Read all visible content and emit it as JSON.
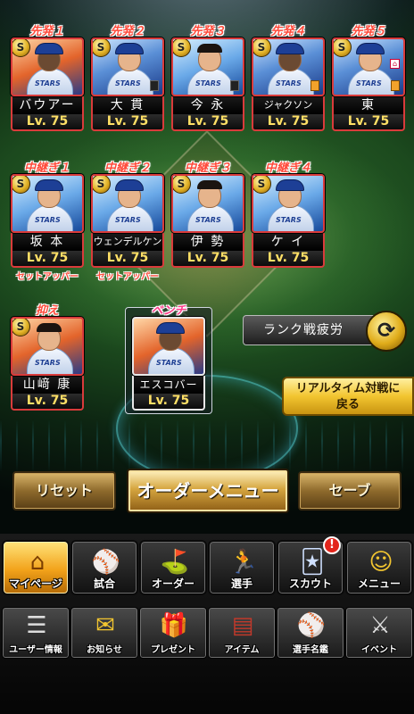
{
  "rotation": [
    {
      "label": "先発１",
      "name": "バウアー",
      "level": "Lv. 75",
      "badge": "S",
      "marker": "",
      "bg": "red-bg",
      "dark": true,
      "cap": true
    },
    {
      "label": "先発２",
      "name": "大 貫",
      "level": "Lv. 75",
      "badge": "S",
      "marker": "black",
      "bg": "",
      "dark": false,
      "cap": true
    },
    {
      "label": "先発３",
      "name": "今 永",
      "level": "Lv. 75",
      "badge": "S",
      "marker": "black",
      "bg": "blue-bg",
      "dark": false,
      "cap": false
    },
    {
      "label": "先発４",
      "name": "ジャクソン",
      "level": "Lv. 75",
      "badge": "S",
      "marker": "orange",
      "bg": "",
      "dark": true,
      "cap": true
    },
    {
      "label": "先発５",
      "name": "東",
      "level": "Lv. 75",
      "badge": "S",
      "marker": "orange",
      "bg": "",
      "dark": false,
      "cap": true
    }
  ],
  "relievers": [
    {
      "label": "中継ぎ１",
      "name": "坂 本",
      "level": "Lv. 75",
      "badge": "S",
      "role": "セットアッパー"
    },
    {
      "label": "中継ぎ２",
      "name": "ウェンデルケン",
      "level": "Lv. 75",
      "badge": "S",
      "role": "セットアッパー"
    },
    {
      "label": "中継ぎ３",
      "name": "伊 勢",
      "level": "Lv. 75",
      "badge": "S",
      "role": ""
    },
    {
      "label": "中継ぎ４",
      "name": "ケ イ",
      "level": "Lv. 75",
      "badge": "S",
      "role": ""
    }
  ],
  "closer": {
    "label": "抑え",
    "name": "山﨑 康",
    "level": "Lv. 75",
    "badge": "S"
  },
  "bench": {
    "label": "ベンチ",
    "name": "エスコバー",
    "level": "Lv. 75"
  },
  "fatigue": {
    "label": "ランク戦疲労",
    "icon": "swap-arrows-icon"
  },
  "realtime": {
    "line1": "リアルタイム対戦に",
    "line2": "戻る"
  },
  "actions": {
    "reset": "リセット",
    "order_menu": "オーダーメニュー",
    "save": "セーブ"
  },
  "main_menu": [
    {
      "label": "マイページ",
      "icon": "home-icon",
      "glyph": "⌂"
    },
    {
      "label": "試合",
      "icon": "stadium-icon",
      "glyph": "⚾"
    },
    {
      "label": "オーダー",
      "icon": "field-formation-icon",
      "glyph": "⛳"
    },
    {
      "label": "選手",
      "icon": "player-icon",
      "glyph": "🏃"
    },
    {
      "label": "スカウト",
      "icon": "scout-card-icon",
      "glyph": "🃏",
      "alert": "!"
    },
    {
      "label": "メニュー",
      "icon": "menu-character-icon",
      "glyph": "☺"
    }
  ],
  "sub_menu": [
    {
      "label": "ユーザー情報",
      "icon": "user-info-icon",
      "glyph": "☰"
    },
    {
      "label": "お知らせ",
      "icon": "notice-icon",
      "glyph": "✉"
    },
    {
      "label": "プレゼント",
      "icon": "present-icon",
      "glyph": "🎁"
    },
    {
      "label": "アイテム",
      "icon": "item-icon",
      "glyph": "▤"
    },
    {
      "label": "選手名鑑",
      "icon": "player-directory-icon",
      "glyph": "⚾"
    },
    {
      "label": "イベント",
      "icon": "event-icon",
      "glyph": "⚔"
    }
  ],
  "colors": {
    "accent_red": "#d93b3b",
    "level_yellow": "#ffe066",
    "gold": "#f2c530"
  }
}
